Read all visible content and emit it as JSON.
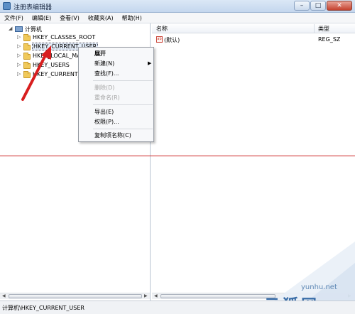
{
  "window": {
    "title": "注册表编辑器",
    "buttons": {
      "minimize": "–",
      "maximize": "□",
      "close": "✕"
    }
  },
  "menu": [
    "文件(F)",
    "编辑(E)",
    "查看(V)",
    "收藏夹(A)",
    "帮助(H)"
  ],
  "tree": {
    "root": "计算机",
    "items": [
      {
        "label": "HKEY_CLASSES_ROOT",
        "selected": false
      },
      {
        "label": "HKEY_CURRENT_USER",
        "selected": true
      },
      {
        "label": "HKEY_LOCAL_MA",
        "selected": false
      },
      {
        "label": "HKEY_USERS",
        "selected": false
      },
      {
        "label": "HKEY_CURRENT_",
        "selected": false
      }
    ]
  },
  "list": {
    "columns": [
      "名称",
      "类型"
    ],
    "rows": [
      {
        "name": "(默认)",
        "type": "REG_SZ",
        "icon": "reg-string-icon"
      }
    ]
  },
  "context_menu": {
    "items": [
      {
        "label": "展开",
        "bold": true,
        "disabled": false
      },
      {
        "label": "新建(N)",
        "bold": false,
        "disabled": false,
        "submenu": true
      },
      {
        "label": "查找(F)...",
        "bold": false,
        "disabled": false
      },
      {
        "label": "删除(D)",
        "bold": false,
        "disabled": true
      },
      {
        "label": "重命名(R)",
        "bold": false,
        "disabled": true
      },
      {
        "label": "导出(E)",
        "bold": false,
        "disabled": false
      },
      {
        "label": "权限(P)...",
        "bold": false,
        "disabled": false
      },
      {
        "label": "复制项名称(C)",
        "bold": false,
        "disabled": false
      }
    ],
    "submenu_arrow": "▶"
  },
  "statusbar": {
    "path": "计算机\\HKEY_CURRENT_USER"
  },
  "watermark": {
    "url": "yunhu.net",
    "logo": "云狐网"
  },
  "colors": {
    "annotation": "#cc2222",
    "accent": "#3b6ea8"
  }
}
